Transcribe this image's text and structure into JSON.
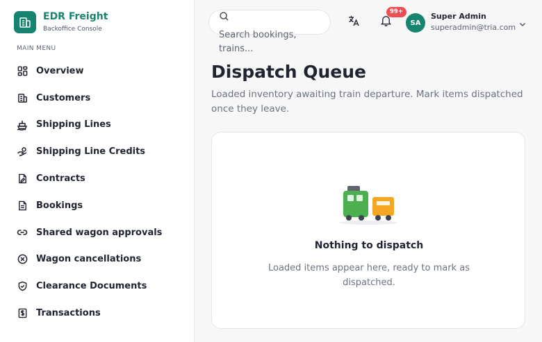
{
  "brand": {
    "name": "EDR Freight",
    "subtitle": "Backoffice Console",
    "logo_icon": "building-icon"
  },
  "sidebar": {
    "heading": "MAIN MENU",
    "items": [
      {
        "label": "Overview",
        "icon": "grid-icon"
      },
      {
        "label": "Customers",
        "icon": "building-icon"
      },
      {
        "label": "Shipping Lines",
        "icon": "ship-icon"
      },
      {
        "label": "Shipping Line Credits",
        "icon": "hand-coins-icon"
      },
      {
        "label": "Contracts",
        "icon": "file-signature-icon"
      },
      {
        "label": "Bookings",
        "icon": "document-icon"
      },
      {
        "label": "Shared wagon approvals",
        "icon": "link-icon"
      },
      {
        "label": "Wagon cancellations",
        "icon": "x-circle-icon"
      },
      {
        "label": "Clearance Documents",
        "icon": "shield-check-icon"
      },
      {
        "label": "Transactions",
        "icon": "receipt-dollar-icon"
      }
    ]
  },
  "header": {
    "search": {
      "placeholder": "Search bookings, trains...",
      "icon": "search-icon"
    },
    "translate_icon": "translate-icon",
    "notifications": {
      "icon": "bell-icon",
      "badge": "99+"
    },
    "user": {
      "initials": "SA",
      "name": "Super Admin",
      "email": "superadmin@tria.com"
    }
  },
  "main": {
    "title": "Dispatch Queue",
    "description": "Loaded inventory awaiting train departure. Mark items dispatched once they leave.",
    "empty_state": {
      "title": "Nothing to dispatch",
      "description": "Loaded items appear here, ready to mark as dispatched.",
      "illustration": "train-icon"
    }
  },
  "colors": {
    "brand": "#16846e",
    "badge": "#ef4d55",
    "train_green": "#4caf50",
    "train_orange": "#f5a623"
  }
}
